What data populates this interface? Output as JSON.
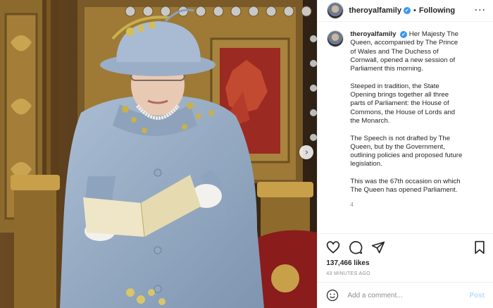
{
  "header": {
    "username": "theroyalfamily",
    "verified_mark": "✔",
    "separator": "•",
    "follow_label": "Following",
    "more_label": "···"
  },
  "caption": {
    "username": "theroyalfamily",
    "paragraphs": [
      "Her Majesty The Queen, accompanied by The Prince of Wales and The Duchess of Cornwall, opened a new session of Parliament this morning.",
      "Steeped in tradition, the State Opening brings together all three parts of Parliament: the House of Commons, the House of Lords and the Monarch.",
      "The Speech is not drafted by The Queen, but by the Government, outlining policies and proposed future legislation.",
      "This was the 67th occasion on which The Queen has opened Parliament."
    ],
    "time_fragment": "4"
  },
  "photo": {
    "description_icon": "photo-queen-throne",
    "next_icon": "chevron-right-icon",
    "next_glyph": "›"
  },
  "actions": {
    "like_icon": "heart-icon",
    "comment_icon": "comment-icon",
    "share_icon": "share-icon",
    "save_icon": "bookmark-icon"
  },
  "likes": "137,466 likes",
  "time_ago": "43 MINUTES AGO",
  "comment": {
    "placeholder": "Add a comment...",
    "post_label": "Post",
    "emoji_icon": "smiley-icon"
  },
  "colors": {
    "accent": "#3897f0",
    "post_disabled": "#b2dffc",
    "coat": "#9bb0c8",
    "throne_red": "#8a1c1c",
    "gold": "#b58a3c"
  }
}
